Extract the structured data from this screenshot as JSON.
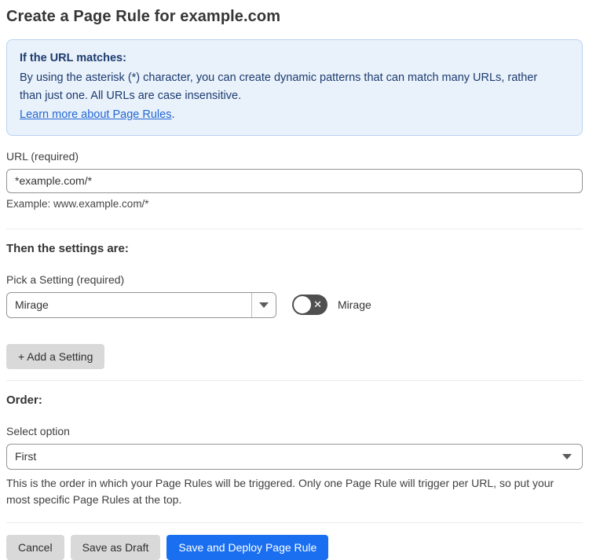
{
  "page": {
    "title": "Create a Page Rule for example.com"
  },
  "info_box": {
    "heading": "If the URL matches:",
    "body": "By using the asterisk (*) character, you can create dynamic patterns that can match many URLs, rather than just one. All URLs are case insensitive.",
    "link_label": "Learn more about Page Rules",
    "link_suffix": "."
  },
  "url_field": {
    "label": "URL (required)",
    "value": "*example.com/*",
    "helper": "Example: www.example.com/*"
  },
  "settings_section": {
    "heading": "Then the settings are:",
    "picker_label": "Pick a Setting (required)",
    "picker_value": "Mirage",
    "toggle_label": "Mirage",
    "toggle_state": "off",
    "add_button_label": "+ Add a Setting"
  },
  "order_section": {
    "heading": "Order:",
    "select_label": "Select option",
    "select_value": "First",
    "helper": "This is the order in which your Page Rules will be triggered. Only one Page Rule will trigger per URL, so put your most specific Page Rules at the top."
  },
  "footer": {
    "cancel_label": "Cancel",
    "save_draft_label": "Save as Draft",
    "save_deploy_label": "Save and Deploy Page Rule"
  },
  "colors": {
    "accent_blue": "#1a6ff0",
    "info_bg": "#e9f1fb",
    "info_border": "#b9d3ef",
    "info_text": "#1d3c6e",
    "link_blue": "#2268d3",
    "toggle_off_gray": "#4f4f4f",
    "button_gray": "#d9d9d9"
  }
}
